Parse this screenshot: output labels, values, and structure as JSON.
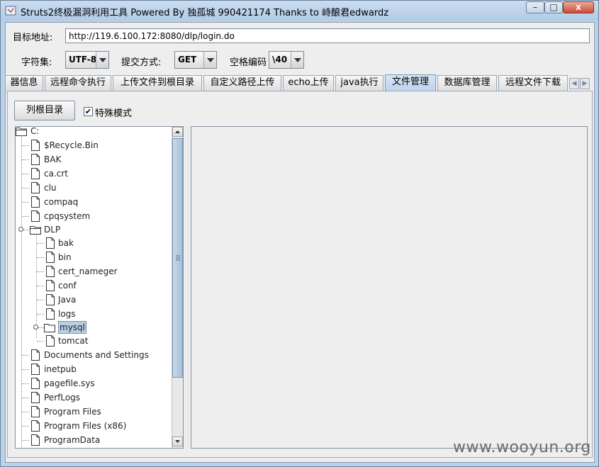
{
  "window": {
    "title": "Struts2终极漏洞利用工具   Powered By 独孤城 990421174 Thanks to 峙酿君edwardz",
    "buttons": {
      "minimize": "–",
      "maximize": "□",
      "close": "x"
    }
  },
  "form": {
    "target_label": "目标地址:",
    "target_value": "http://119.6.100.172:8080/dlp/login.do",
    "charset_label": "字符集:",
    "charset_value": "UTF-8",
    "method_label": "提交方式:",
    "method_value": "GET",
    "space_label": "空格编码",
    "space_value": "\\40"
  },
  "tabs": [
    {
      "label": "器信息"
    },
    {
      "label": "远程命令执行"
    },
    {
      "label": "上传文件到根目录"
    },
    {
      "label": "自定义路径上传"
    },
    {
      "label": "echo上传"
    },
    {
      "label": "java执行"
    },
    {
      "label": "文件管理"
    },
    {
      "label": "数据库管理"
    },
    {
      "label": "远程文件下载"
    }
  ],
  "active_tab": "文件管理",
  "file_manager": {
    "list_root_button": "列根目录",
    "special_mode_label": "特殊模式",
    "special_mode_checked": "✔",
    "tree": {
      "root": "C:",
      "items": [
        {
          "label": "$Recycle.Bin",
          "type": "file",
          "level": 1
        },
        {
          "label": "BAK",
          "type": "file",
          "level": 1
        },
        {
          "label": "ca.crt",
          "type": "file",
          "level": 1
        },
        {
          "label": "clu",
          "type": "file",
          "level": 1
        },
        {
          "label": "compaq",
          "type": "file",
          "level": 1
        },
        {
          "label": "cpqsystem",
          "type": "file",
          "level": 1
        },
        {
          "label": "DLP",
          "type": "folder",
          "level": 1
        },
        {
          "label": "bak",
          "type": "file",
          "level": 2
        },
        {
          "label": "bin",
          "type": "file",
          "level": 2
        },
        {
          "label": "cert_nameger",
          "type": "file",
          "level": 2
        },
        {
          "label": "conf",
          "type": "file",
          "level": 2
        },
        {
          "label": "Java",
          "type": "file",
          "level": 2
        },
        {
          "label": "logs",
          "type": "file",
          "level": 2
        },
        {
          "label": "mysql",
          "type": "folder",
          "level": 2,
          "selected": true
        },
        {
          "label": "tomcat",
          "type": "file",
          "level": 2
        },
        {
          "label": "Documents and Settings",
          "type": "file",
          "level": 1
        },
        {
          "label": "inetpub",
          "type": "file",
          "level": 1
        },
        {
          "label": "pagefile.sys",
          "type": "file",
          "level": 1
        },
        {
          "label": "PerfLogs",
          "type": "file",
          "level": 1
        },
        {
          "label": "Program Files",
          "type": "file",
          "level": 1
        },
        {
          "label": "Program Files (x86)",
          "type": "file",
          "level": 1
        },
        {
          "label": "ProgramData",
          "type": "file",
          "level": 1
        }
      ]
    }
  },
  "watermark": "www.wooyun.org"
}
